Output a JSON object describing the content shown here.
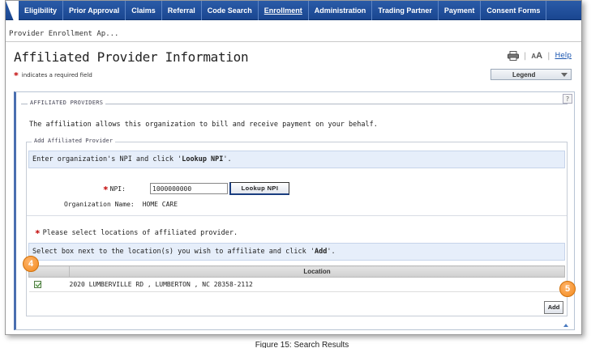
{
  "nav": {
    "items": [
      {
        "label": "Eligibility"
      },
      {
        "label": "Prior Approval"
      },
      {
        "label": "Claims"
      },
      {
        "label": "Referral"
      },
      {
        "label": "Code Search"
      },
      {
        "label": "Enrollment"
      },
      {
        "label": "Administration"
      },
      {
        "label": "Trading Partner"
      },
      {
        "label": "Payment"
      },
      {
        "label": "Consent Forms"
      }
    ],
    "active": "Enrollment"
  },
  "breadcrumb": "Provider Enrollment Ap...",
  "page_title": "Affiliated Provider Information",
  "required_note": "indicates a required field",
  "required_star": "*",
  "tools": {
    "print_icon": "printer-icon",
    "font_size_label": "A",
    "font_size_label_large": "A",
    "help_label": "Help"
  },
  "legend_select": {
    "value": "Legend"
  },
  "help_question": "?",
  "affiliated": {
    "section_legend": "AFFILIATED PROVIDERS",
    "description": "The affiliation allows this organization to bill and receive payment on your behalf.",
    "add_legend": "Add Affiliated Provider",
    "instruction_npi_prefix": "Enter organization's NPI and click '",
    "instruction_npi_action": "Lookup NPI",
    "instruction_npi_suffix": "'.",
    "npi_label": "NPI:",
    "npi_value": "1000000000",
    "lookup_button": "Lookup NPI",
    "org_name_label": "Organization Name:",
    "org_name_value": "HOME CARE",
    "locations_prompt": "Please select locations of affiliated provider.",
    "instruction_loc_prefix": "Select box next to the location(s) you wish to affiliate and click '",
    "instruction_loc_action": "Add",
    "instruction_loc_suffix": "'.",
    "table": {
      "columns": [
        "",
        "Location"
      ],
      "rows": [
        {
          "checked": true,
          "location": "2020 LUMBERVILLE RD , LUMBERTON , NC  28358-2112"
        }
      ]
    },
    "add_button": "Add"
  },
  "callouts": {
    "four": "4",
    "five": "5"
  },
  "caption": "Figure 15: Search Results",
  "colors": {
    "nav_bg": "#1f4f9c",
    "required_star": "#c00000",
    "instruction_bg": "#e6eefa",
    "callout": "#f28a1e"
  }
}
